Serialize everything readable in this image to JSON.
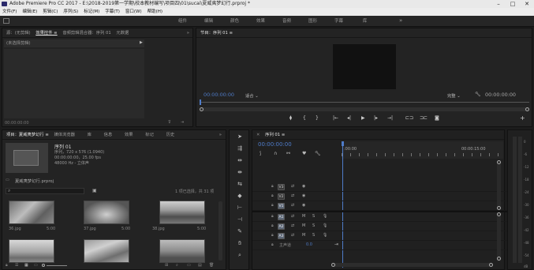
{
  "window": {
    "title": "Adobe Premiere Pro CC 2017 - E:\\2018-2019第一学期\\校本教材编写\\项目四\\01\\sucai\\夏威夷梦幻行.prproj *",
    "controls": [
      "–",
      "□",
      "✕"
    ]
  },
  "menu": [
    "文件(F)",
    "编辑(E)",
    "剪辑(C)",
    "序列(S)",
    "标记(M)",
    "字幕(T)",
    "窗口(W)",
    "帮助(H)"
  ],
  "workspaces": {
    "tabs": [
      "组件",
      "编辑",
      "颜色",
      "效果",
      "音频",
      "图形",
      "字幕",
      "库"
    ],
    "more": "»"
  },
  "source_panel": {
    "tabs": [
      "源：(无剪辑)",
      "效果控件 ≡",
      "音频剪辑混合器：序列 01",
      "元数据"
    ],
    "more": "»",
    "no_clip": "(未选择剪辑)",
    "timecode": "00:00:00:00"
  },
  "program_panel": {
    "tab": "节目：序列 01 ≡",
    "timecode_left": "00:00:00:00",
    "fit": "适合",
    "quality": "完整",
    "timecode_right": "00:00:00:00",
    "transport": [
      "⧫",
      "{",
      "}",
      "|←",
      "◂|",
      "▶",
      "|▸",
      "→|",
      "⊏⊐",
      "⊐⊏",
      "◙",
      "+"
    ]
  },
  "project_panel": {
    "tabs": [
      "项目：夏威夷梦幻行 ≡",
      "媒体浏览器",
      "库",
      "信息",
      "效果",
      "标记",
      "历史"
    ],
    "more": "»",
    "seq_name": "序列 01",
    "seq_info": [
      "序列，720 x 576 (1.0940)",
      "00:00:00:00，25.00 fps",
      "48000 Hz - 立体声"
    ],
    "project_file": "夏威夷梦幻行.prproj",
    "selection": "1 项已选择，共 31 项",
    "clips": [
      {
        "name": "36.jpg",
        "duration": "5:00"
      },
      {
        "name": "37.jpg",
        "duration": "5:00"
      },
      {
        "name": "38.jpg",
        "duration": "5:00"
      }
    ]
  },
  "timeline": {
    "tab": "序列 01 ≡",
    "timecode": "00:00:00:00",
    "ruler": [
      ":00:00",
      "00:00:15:00"
    ],
    "video_tracks": [
      "V3",
      "V2",
      "V1"
    ],
    "audio_tracks": [
      "A1",
      "A2",
      "A3"
    ],
    "master_label": "主声道",
    "master_value": "0.0",
    "track_buttons": [
      "M",
      "S"
    ]
  },
  "audio_meter": {
    "labels": [
      "0",
      "-6",
      "-12",
      "-18",
      "-24",
      "-30",
      "-36",
      "-42",
      "-48",
      "-54",
      "dB"
    ]
  }
}
